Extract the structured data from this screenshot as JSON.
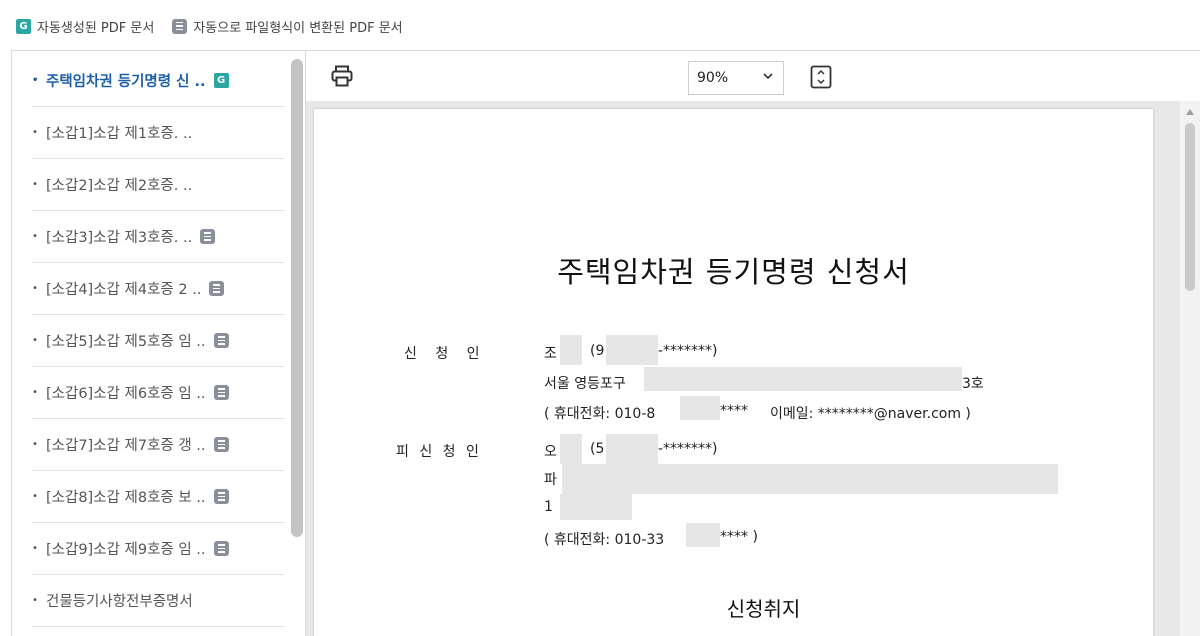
{
  "legend": {
    "generated_label": "자동생성된 PDF 문서",
    "converted_label": "자동으로 파일형식이 변환된 PDF 문서"
  },
  "sidebar": {
    "items": [
      {
        "label": "주택임차권 등기명령 신 ..",
        "badge": "generated",
        "active": true
      },
      {
        "label": "[소갑1]소갑 제1호증. ..",
        "badge": "none",
        "active": false
      },
      {
        "label": "[소갑2]소갑 제2호증. ..",
        "badge": "none",
        "active": false
      },
      {
        "label": "[소갑3]소갑 제3호증. ..",
        "badge": "converted",
        "active": false
      },
      {
        "label": "[소갑4]소갑 제4호증 2 ..",
        "badge": "converted",
        "active": false
      },
      {
        "label": "[소갑5]소갑 제5호증 임 ..",
        "badge": "converted",
        "active": false
      },
      {
        "label": "[소갑6]소갑 제6호증 임 ..",
        "badge": "converted",
        "active": false
      },
      {
        "label": "[소갑7]소갑 제7호증 갱 ..",
        "badge": "converted",
        "active": false
      },
      {
        "label": "[소갑8]소갑 제8호증 보 ..",
        "badge": "converted",
        "active": false
      },
      {
        "label": "[소갑9]소갑 제9호증 임 ..",
        "badge": "converted",
        "active": false
      },
      {
        "label": "건물등기사항전부증명서",
        "badge": "none",
        "active": false
      }
    ]
  },
  "toolbar": {
    "zoom_value": "90%"
  },
  "document": {
    "title": "주택임차권 등기명령 신청서",
    "applicant_label": "신 청 인",
    "applicant_name": "조",
    "applicant_rrn_open": "(9",
    "applicant_rrn_mask": "-*******)",
    "applicant_address": "서울 영등포구",
    "applicant_address_tail": "3호",
    "applicant_phone": "( 휴대전화: 010-8",
    "applicant_phone_mask": "****",
    "applicant_email": "이메일: ********@naver.com )",
    "respondent_label": "피 신 청 인",
    "respondent_name": "오",
    "respondent_rrn_open": "(5",
    "respondent_rrn_mask": "-*******)",
    "respondent_address": "파",
    "respondent_address_2": "1",
    "respondent_phone": "( 휴대전화: 010-33",
    "respondent_phone_mask": "**** )",
    "section_title": "신청취지"
  },
  "colors": {
    "active_item": "#1f5fa8",
    "generated_badge": "#2aa7a3",
    "converted_badge": "#8a8f99"
  }
}
